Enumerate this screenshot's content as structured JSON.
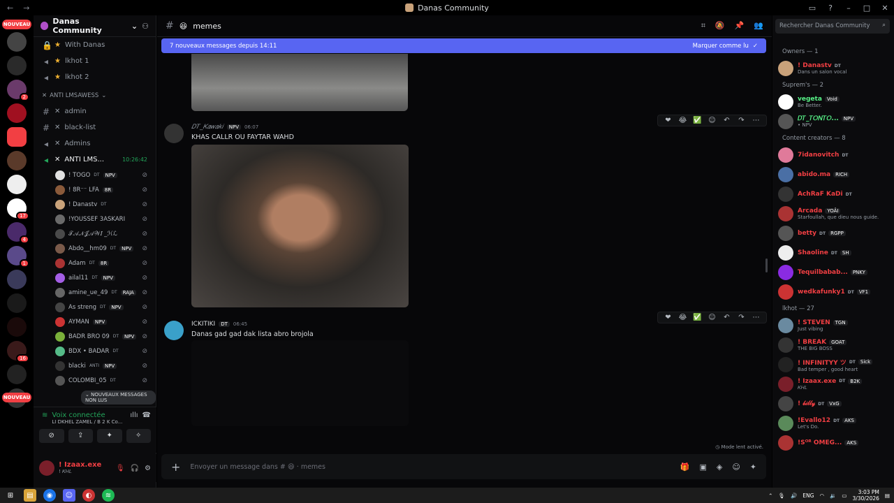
{
  "window": {
    "title": "Danas Community"
  },
  "servers": {
    "badge1": "NOUVEAU",
    "badge2": "NOUVEAU",
    "counts": [
      "2",
      "17",
      "4",
      "1",
      "16"
    ]
  },
  "guild": {
    "name": "Danas Community"
  },
  "channels": {
    "top": [
      {
        "label": "With Danas",
        "type": "lock"
      },
      {
        "label": "lkhot 1",
        "type": "voice"
      },
      {
        "label": "lkhot 2",
        "type": "voice"
      }
    ],
    "category": "ANTI LMSAWESS",
    "list": [
      {
        "label": "admin",
        "type": "text"
      },
      {
        "label": "black-list",
        "type": "text"
      },
      {
        "label": "Admins",
        "type": "voice"
      },
      {
        "label": "ANTI LMS...",
        "type": "voice",
        "time": "10:26:42"
      }
    ],
    "voice_users": [
      {
        "name": "! TOGO",
        "tags": "DT",
        "role": "NPV",
        "color": "#e0e0e0"
      },
      {
        "name": "! 8R⁻⁻ LFA",
        "tags": "",
        "role": "8R",
        "color": "#8a5a3a"
      },
      {
        "name": "! Danastv",
        "tags": "DT",
        "role": "",
        "color": "#c9a27a"
      },
      {
        "name": "!YOUSSEF 3ASKARI",
        "tags": "",
        "role": "",
        "color": "#6a6a6a"
      },
      {
        "name": "𝒯𝒜𝒩𝒥𝒜𝒲𝐼 _ℋℒ",
        "tags": "",
        "role": "",
        "color": "#4a4a4a"
      },
      {
        "name": "Abdo__hm09",
        "tags": "DT",
        "role": "NPV",
        "color": "#7a5a4a"
      },
      {
        "name": "Adam",
        "tags": "DT",
        "role": "8R",
        "color": "#a33"
      },
      {
        "name": "ailal11",
        "tags": "DT",
        "role": "NPV",
        "color": "#a45ee5"
      },
      {
        "name": "amine_ue_49",
        "tags": "DT",
        "role": "RAJA",
        "color": "#666"
      },
      {
        "name": "As streng",
        "tags": "DT",
        "role": "NPV",
        "color": "#444"
      },
      {
        "name": "AYMAN",
        "tags": "",
        "role": "NPV",
        "color": "#c33"
      },
      {
        "name": "BADR BRO 09",
        "tags": "DT",
        "role": "NPV",
        "color": "#7ab03a"
      },
      {
        "name": "BDX • BADAR",
        "tags": "DT",
        "role": "",
        "color": "#5b8"
      },
      {
        "name": "blacki",
        "tags": "ANTI",
        "role": "NPV",
        "color": "#333"
      },
      {
        "name": "COLOMBI_05",
        "tags": "DT",
        "role": "",
        "color": "#555"
      }
    ],
    "unread_pill": "NOUVEAUX MESSAGES NON LUS"
  },
  "voice": {
    "status": "Voix connectée",
    "location": "LI DKHEL ZAMEL / B 2 K Co..."
  },
  "user": {
    "name": "! Izaax.exe",
    "status": "! 𝐾𝐻𝐿"
  },
  "chat": {
    "channel": "memes",
    "new_messages": "7 nouveaux messages depuis 14:11",
    "mark_read": "Marquer comme lu",
    "messages": [
      {
        "author": "𝐷𝑇_𝐾𝑎𝑤𝑎𝑘𝑖",
        "role": "NPV",
        "time": "06:07",
        "text": "KHAS CALLR OU FAYTAR WAHD",
        "color": "#949ba4"
      },
      {
        "author": "ICKITIKI",
        "role": "DT",
        "time": "06:45",
        "text": "Danas gad gad dak lista abro brojola",
        "color": "#dbdee1"
      }
    ],
    "slow_mode": "Mode lent activé.",
    "composer_placeholder": "Envoyer un message dans #",
    "composer_channel": "memes"
  },
  "members": {
    "search_placeholder": "Rechercher Danas Community",
    "groups": [
      {
        "title": "Owners — 1",
        "items": [
          {
            "name": "! Danastv",
            "badge": "DT",
            "status": "Dans un salon vocal",
            "color": "#f23f43",
            "av": "#c9a27a"
          }
        ]
      },
      {
        "title": "Suprem's — 2",
        "items": [
          {
            "name": "vegeta",
            "badge": "",
            "tag": "Void",
            "status": "Be Better.",
            "color": "#57f287",
            "av": "#fff"
          },
          {
            "name": "𝐷𝑇_𝑇𝑂𝑁𝑇𝑂...",
            "badge": "",
            "tag": "NPV",
            "status": "• NPV",
            "color": "#57f287",
            "av": "#555"
          }
        ]
      },
      {
        "title": "Content creators — 8",
        "items": [
          {
            "name": "7idanovitch",
            "badge": "DT",
            "tag": "",
            "status": "",
            "color": "#f23f43",
            "av": "#e07a9a"
          },
          {
            "name": "abido.ma",
            "badge": "",
            "tag": "RICH",
            "status": "",
            "color": "#f23f43",
            "av": "#4a6fa5"
          },
          {
            "name": "AchRaF KaDi",
            "badge": "DT",
            "tag": "",
            "status": "",
            "color": "#f23f43",
            "av": "#333"
          },
          {
            "name": "Arcada",
            "badge": "",
            "tag": "YOÂI",
            "status": "Starfoullah, que dieu nous guide.",
            "color": "#f23f43",
            "av": "#a33"
          },
          {
            "name": "betty",
            "badge": "DT",
            "tag": "RGPP",
            "status": "",
            "color": "#f23f43",
            "av": "#555"
          },
          {
            "name": "Shaoline",
            "badge": "DT",
            "tag": "SH",
            "status": "",
            "color": "#f23f43",
            "av": "#eee"
          },
          {
            "name": "Tequilbabab...",
            "badge": "",
            "tag": "PNKY",
            "status": "",
            "color": "#f23f43",
            "av": "#8a2be2"
          },
          {
            "name": "wedkafunky1",
            "badge": "DT",
            "tag": "VF1",
            "status": "",
            "color": "#f23f43",
            "av": "#c33"
          }
        ]
      },
      {
        "title": "lkhot — 27",
        "items": [
          {
            "name": "! STEVEN",
            "badge": "",
            "tag": "TGN",
            "status": "Just vibing",
            "color": "#f23f43",
            "av": "#6a8aa0"
          },
          {
            "name": "! BREAK",
            "badge": "",
            "tag": "GOAT",
            "status": "THE BIG BOSS",
            "color": "#f23f43",
            "av": "#333"
          },
          {
            "name": "! INFINITYY ツ",
            "badge": "DT",
            "tag": "Sick",
            "status": "Bad temper , good heart",
            "color": "#f23f43",
            "av": "#222"
          },
          {
            "name": "! Izaax.exe",
            "badge": "DT",
            "tag": "B2K",
            "status": "𝐾𝐻𝐿",
            "color": "#f23f43",
            "av": "#7a1f2a"
          },
          {
            "name": "! 𝒷𝒾𝓁𝓁𝓎",
            "badge": "DT",
            "tag": "VxG",
            "status": "",
            "color": "#f23f43",
            "av": "#444"
          },
          {
            "name": "!Evallo12",
            "badge": "DT",
            "tag": "AKS",
            "status": "Let's Do.",
            "color": "#f23f43",
            "av": "#5a8a5a"
          },
          {
            "name": "!Sᴼᴿ OMEG...",
            "badge": "",
            "tag": "AKS",
            "status": "",
            "color": "#f23f43",
            "av": "#a33"
          }
        ]
      }
    ]
  },
  "taskbar": {
    "time": "3:03 PM",
    "date": "3/30/2026",
    "lang": "ENG"
  },
  "colors": {
    "accent": "#5865f2",
    "bg": "#070709",
    "red": "#f23f43",
    "green": "#23a55a"
  }
}
